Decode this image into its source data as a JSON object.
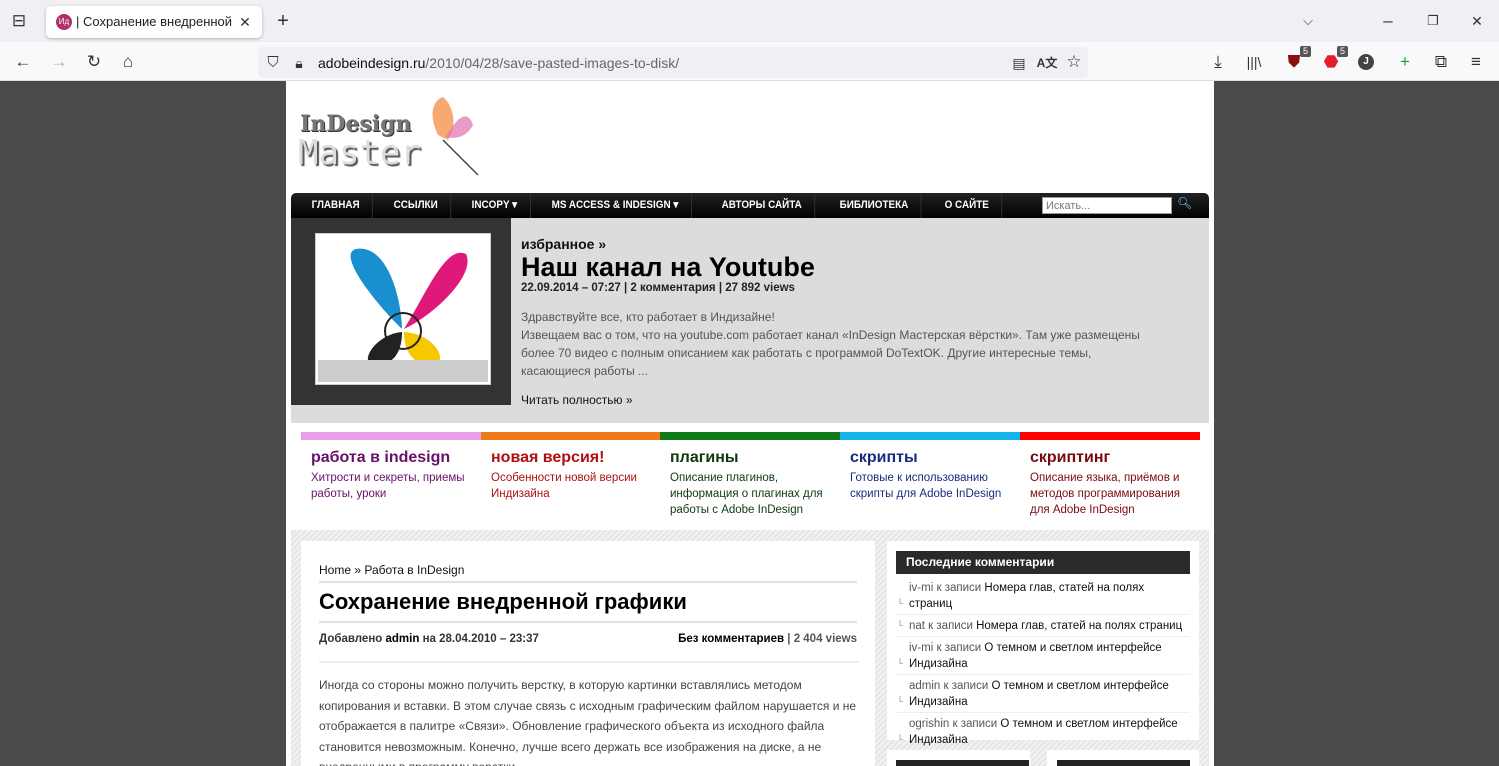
{
  "browser": {
    "tab_title": "| Сохранение внедренной графики",
    "favicon_text": "Ид",
    "url_domain": "adobeindesign.ru",
    "url_path": "/2010/04/28/save-pasted-images-to-disk/",
    "badge_ublock": "5",
    "badge_abp": "5",
    "profile_initial": "J"
  },
  "site": {
    "logo_line1": "InDesign",
    "logo_line2": "Master",
    "nav": [
      "ГЛАВНАЯ",
      "ССЫЛКИ",
      "INCOPY",
      "MS ACCESS & INDESIGN",
      "АВТОРЫ САЙТА",
      "БИБЛИОТЕКА",
      "О САЙТЕ"
    ],
    "search_placeholder": "Искать..."
  },
  "featured": {
    "kicker": "избранное »",
    "title": "Наш канал на Youtube",
    "date": "22.09.2014 – 07:27",
    "comments": "2 комментария",
    "views": "27 892 views",
    "p1": "Здравствуйте все, кто работает в Индизайне!",
    "p2": "Извещаем вас о том, что на youtube.com работает канал «InDesign Мастерская вёрстки». Там уже размещены более 70 видео с полным описанием как работать с программой DoTextOK. Другие интересные темы, касающиеся работы ...",
    "more": "Читать полностью »"
  },
  "categories": [
    {
      "title": "работа в indesign",
      "desc": "Хитрости и секреты, приемы работы, уроки",
      "bar": "#e8a0e8",
      "color": "#6a0f6a"
    },
    {
      "title": "новая версия!",
      "desc": "Особенности новой версии Индизайна",
      "bar": "#f07a18",
      "color": "#b01010"
    },
    {
      "title": "плагины",
      "desc": "Описание плагинов, информация о плагинах для работы с Adobe InDesign",
      "bar": "#117a1a",
      "color": "#0c3a10"
    },
    {
      "title": "скрипты",
      "desc": "Готовые к использованию скрипты для Adobe InDesign",
      "bar": "#12b4ea",
      "color": "#1a2a80"
    },
    {
      "title": "скриптинг",
      "desc": "Описание языка, приёмов и методов программирования для Adobe InDesign",
      "bar": "#ff0000",
      "color": "#7a0a10"
    }
  ],
  "article": {
    "breadcrumb_home": "Home",
    "breadcrumb_sep": " » ",
    "breadcrumb_cat": "Работа в InDesign",
    "title": "Сохранение внедренной графики",
    "added": "Добавлено",
    "author": "admin",
    "on": "на 28.04.2010 – 23:37",
    "no_comments": "Без комментариев",
    "views": "| 2 404 views",
    "body": "Иногда со стороны можно получить верстку, в которую картинки вставлялись методом копирования и вставки. В этом случае связь с исходным графическим файлом нарушается и не отображается в палитре «Связи». Обновление графического объекта из исходного файла становится невозможным. Конечно, лучше всего держать все изображения на диске, а не внедренными в программу верстки."
  },
  "sidebar": {
    "title": "Последние комментарии",
    "comments": [
      {
        "who": "iv-mi к записи",
        "post": "Номера глав, статей на полях страниц"
      },
      {
        "who": "nat к записи",
        "post": "Номера глав, статей на полях страниц"
      },
      {
        "who": "iv-mi к записи",
        "post": "О темном и светлом интерфейсе Индизайна"
      },
      {
        "who": "admin к записи",
        "post": "О темном и светлом интерфейсе Индизайна"
      },
      {
        "who": "ogrishin к записи",
        "post": "О темном и светлом интерфейсе Индизайна"
      }
    ]
  }
}
